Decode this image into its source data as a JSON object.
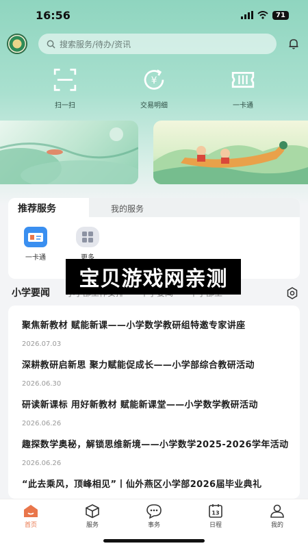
{
  "status_bar": {
    "time": "16:56",
    "battery": "71"
  },
  "search": {
    "placeholder": "搜索服务/待办/资讯"
  },
  "quick_actions": [
    {
      "label": "扫一扫",
      "icon": "scan-icon"
    },
    {
      "label": "交易明细",
      "icon": "yen-refresh-icon"
    },
    {
      "label": "一卡通",
      "icon": "card-icon"
    }
  ],
  "services": {
    "tabs": [
      "推荐服务",
      "我的服务"
    ],
    "items": [
      {
        "label": "一卡通",
        "icon": "id-card-icon"
      },
      {
        "label": "更多",
        "icon": "grid-icon"
      }
    ]
  },
  "news": {
    "tabs": [
      "小学要闻",
      "小学部工作安排",
      "中学要闻",
      "中学部工"
    ],
    "items": [
      {
        "title": "聚焦新教材 赋能新课——小学数学教研组特邀专家讲座",
        "date": "2026.07.03"
      },
      {
        "title": "深耕教研启新思 聚力赋能促成长——小学部综合教研活动",
        "date": "2026.06.30"
      },
      {
        "title": "研读新课标 用好新教材 赋能新课堂——小学数学教研活动",
        "date": "2026.06.26"
      },
      {
        "title": "趣探数学奥秘，解锁思维新境——小学数学2025-2026学年活动",
        "date": "2026.06.26"
      },
      {
        "title": "“此去乘风，顶峰相见”丨仙外燕区小学部2026届毕业典礼",
        "date": ""
      }
    ]
  },
  "watermark": "宝贝游戏网亲测",
  "tabbar": [
    {
      "label": "首页",
      "icon": "home-icon"
    },
    {
      "label": "服务",
      "icon": "cube-icon"
    },
    {
      "label": "事务",
      "icon": "chat-icon"
    },
    {
      "label": "日程",
      "icon": "calendar-icon"
    },
    {
      "label": "我的",
      "icon": "user-icon"
    }
  ],
  "calendar_day": "13",
  "colors": {
    "brand": "#8fd5bf",
    "accent": "#e9764b",
    "icon_teal": "#3e8f78"
  }
}
